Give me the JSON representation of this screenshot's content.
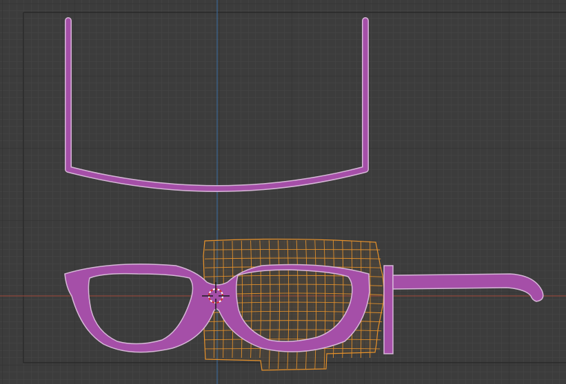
{
  "viewport": {
    "view": "top-orthographic",
    "background_color": "#3c3c3c",
    "grid_minor_color": "#474747",
    "grid_major_color": "#2d2d2d",
    "axis_x_color": "#a3483a",
    "axis_y_color": "#3a6ea3"
  },
  "objects": {
    "temple_arm_u": {
      "label": "",
      "color": "#a54fa8",
      "outline": "#d7b8d8"
    },
    "glasses_front": {
      "label": "",
      "color": "#a54fa8",
      "outline": "#d7b8d8"
    },
    "glasses_temple": {
      "label": "",
      "color": "#a54fa8",
      "outline": "#d7b8d8"
    }
  },
  "deform_lattice": {
    "color": "#e8922a",
    "selected": true
  },
  "cursor_3d": {
    "icon": "3d-cursor-icon"
  }
}
